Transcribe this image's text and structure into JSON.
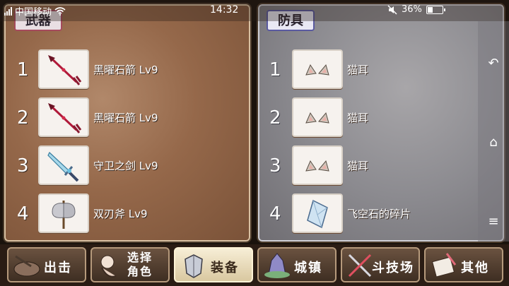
{
  "status": {
    "carrier": "中国移动",
    "network": "2G",
    "time": "14:32",
    "battery": "36%"
  },
  "weapons": {
    "title": "武器",
    "items": [
      {
        "num": "1",
        "name": "黑曜石箭 Lv9",
        "icon": "obsidian-arrow-icon"
      },
      {
        "num": "2",
        "name": "黑曜石箭 Lv9",
        "icon": "obsidian-arrow-icon"
      },
      {
        "num": "3",
        "name": "守卫之剑 Lv9",
        "icon": "guard-sword-icon"
      },
      {
        "num": "4",
        "name": "双刃斧 Lv9",
        "icon": "double-axe-icon"
      }
    ]
  },
  "armor": {
    "title": "防具",
    "items": [
      {
        "num": "1",
        "name": "猫耳",
        "icon": "cat-ears-icon"
      },
      {
        "num": "2",
        "name": "猫耳",
        "icon": "cat-ears-icon"
      },
      {
        "num": "3",
        "name": "猫耳",
        "icon": "cat-ears-icon"
      },
      {
        "num": "4",
        "name": "飞空石的碎片",
        "icon": "crystal-shard-icon"
      }
    ]
  },
  "nav": {
    "sortie": "出击",
    "select_line1": "选择",
    "select_line2": "角色",
    "equip": "装备",
    "town": "城镇",
    "arena": "斗技场",
    "other": "其他"
  },
  "colors": {
    "weapon_accent": "#a54a5c",
    "armor_accent": "#5a5aa0",
    "active_tab": "#f7eed6"
  }
}
